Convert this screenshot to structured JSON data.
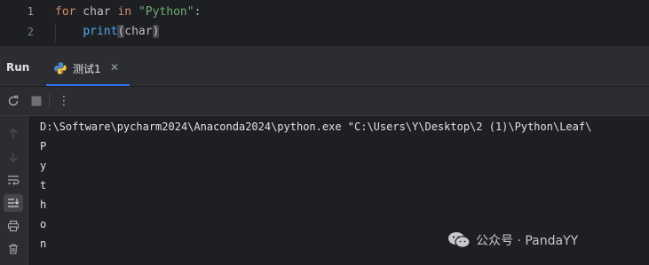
{
  "editor": {
    "line_numbers": [
      "1",
      "2"
    ],
    "lines": [
      {
        "keyword_for": "for",
        "var": " char ",
        "keyword_in": "in",
        "space": " ",
        "string": "\"Python\"",
        "colon": ":"
      },
      {
        "indent": "    ",
        "func": "print",
        "open": "(",
        "arg": "char",
        "close": ")"
      }
    ]
  },
  "run_panel": {
    "title": "Run",
    "tab": {
      "label": "测试1",
      "close": "✕",
      "icon": "python-icon"
    }
  },
  "toolbar": {
    "rerun": "rerun-icon",
    "stop": "stop-icon",
    "more": "⋮"
  },
  "side": {
    "icons": [
      "arrow-up-icon",
      "arrow-down-icon",
      "soft-wrap-icon",
      "scroll-to-end-icon",
      "print-icon",
      "trash-icon"
    ]
  },
  "console": {
    "lines": [
      "D:\\Software\\pycharm2024\\Anaconda2024\\python.exe \"C:\\Users\\Y\\Desktop\\2 (1)\\Python\\Leaf\\",
      "P",
      "y",
      "t",
      "h",
      "o",
      "n"
    ]
  },
  "watermark": {
    "text": "公众号 · PandaYY"
  },
  "colors": {
    "background": "#1e1f22",
    "panel": "#2b2d30",
    "keyword": "#cf8e6d",
    "string": "#6aab73",
    "function": "#56a8f5",
    "accent": "#3574f0"
  }
}
